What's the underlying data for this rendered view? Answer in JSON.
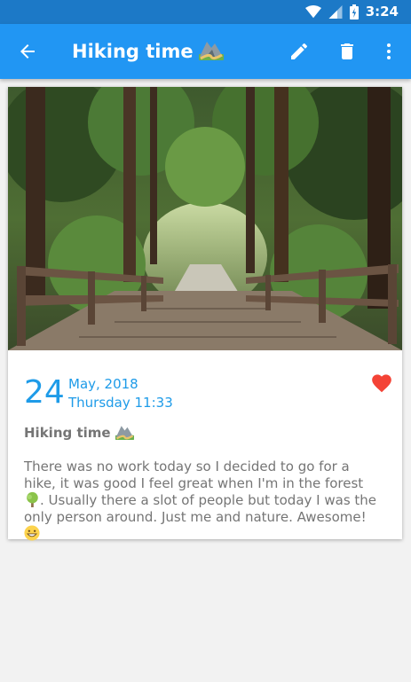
{
  "status_bar": {
    "time": "3:24"
  },
  "app_bar": {
    "title": "Hiking time",
    "title_emoji": "mountain-road-icon"
  },
  "entry": {
    "day": "24",
    "month_year": "May, 2018",
    "weekday_time": "Thursday 11:33",
    "title": "Hiking time",
    "body_part1": "There was no work today so I decided to go for a hike, it was good I feel great when I'm in the forest ",
    "body_part2": ". Usually there a slot of people but today I was the only person around. Just me and nature. Awesome! ",
    "favorite": true
  },
  "colors": {
    "status_bar": "#1c79c7",
    "app_bar": "#2196f3",
    "accent": "#1e9be8",
    "heart": "#f44336",
    "text_grey": "#757575"
  }
}
